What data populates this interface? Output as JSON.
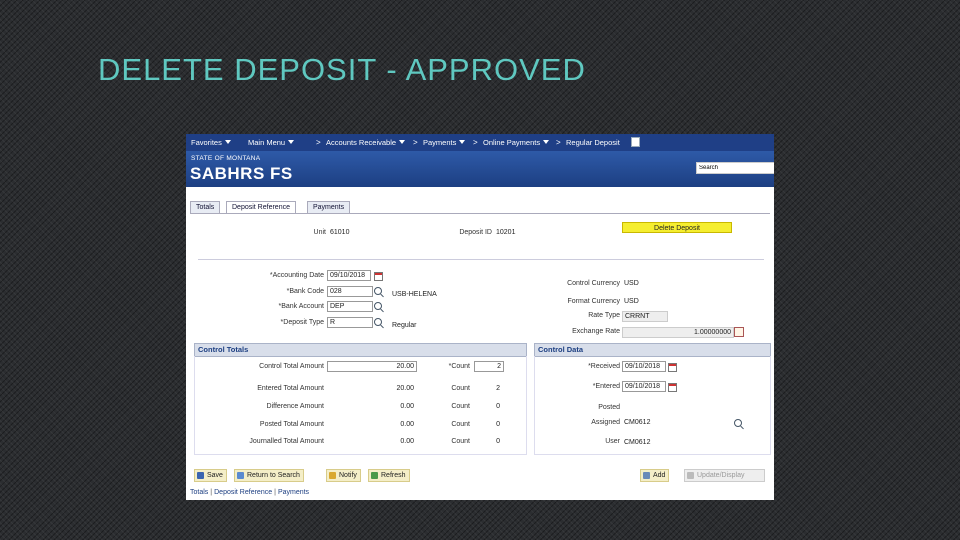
{
  "slide": {
    "title": "DELETE DEPOSIT - APPROVED"
  },
  "nav": {
    "favorites": "Favorites",
    "main_menu": "Main Menu",
    "accounts_receivable": "Accounts Receivable",
    "payments": "Payments",
    "online_payments": "Online Payments",
    "regular_deposit": "Regular Deposit",
    "separator": ">"
  },
  "banner": {
    "state": "STATE OF MONTANA",
    "system": "SABHRS FS",
    "search_value": "Search"
  },
  "tabs": [
    {
      "label": "Totals"
    },
    {
      "label": "Deposit Reference"
    },
    {
      "label": "Payments"
    }
  ],
  "header": {
    "unit_label": "Unit",
    "unit_value": "61010",
    "deposit_id_label": "Deposit ID",
    "deposit_id_value": "10201",
    "delete_button": "Delete Deposit"
  },
  "deposit": {
    "accounting_date_label": "*Accounting Date",
    "accounting_date_value": "09/10/2018",
    "bank_code_label": "*Bank Code",
    "bank_code_value": "028",
    "bank_name": "USB-HELENA",
    "bank_account_label": "*Bank Account",
    "bank_account_value": "DEP",
    "deposit_type_label": "*Deposit Type",
    "deposit_type_value": "R",
    "deposit_type_desc": "Regular"
  },
  "currency": {
    "control_currency_label": "Control Currency",
    "control_currency_value": "USD",
    "format_currency_label": "Format Currency",
    "format_currency_value": "USD",
    "rate_type_label": "Rate Type",
    "rate_type_value": "CRRNT",
    "exchange_rate_label": "Exchange Rate",
    "exchange_rate_value": "1.00000000"
  },
  "control_totals": {
    "header": "Control Totals",
    "control_total_label": "Control Total Amount",
    "control_total_value": "20.00",
    "control_count_label": "*Count",
    "control_count_value": "2",
    "entered_total_label": "Entered Total Amount",
    "entered_total_value": "20.00",
    "entered_count_label": "Count",
    "entered_count_value": "2",
    "difference_label": "Difference Amount",
    "difference_value": "0.00",
    "difference_count_label": "Count",
    "difference_count_value": "0",
    "posted_label": "Posted Total Amount",
    "posted_value": "0.00",
    "posted_count_label": "Count",
    "posted_count_value": "0",
    "journalled_label": "Journalled Total Amount",
    "journalled_value": "0.00",
    "journalled_count_label": "Count",
    "journalled_count_value": "0"
  },
  "control_data": {
    "header": "Control Data",
    "received_label": "*Received",
    "received_value": "09/10/2018",
    "entered_label": "*Entered",
    "entered_value": "09/10/2018",
    "posted_label": "Posted",
    "assigned_label": "Assigned",
    "assigned_value": "CM0612",
    "user_label": "User",
    "user_value": "CM0612"
  },
  "toolbar": {
    "save": "Save",
    "return_to_search": "Return to Search",
    "notify": "Notify",
    "refresh": "Refresh",
    "add": "Add",
    "update_display": "Update/Display"
  },
  "footer": {
    "totals": "Totals",
    "deposit_reference": "Deposit Reference",
    "payments": "Payments",
    "separator": "|"
  }
}
